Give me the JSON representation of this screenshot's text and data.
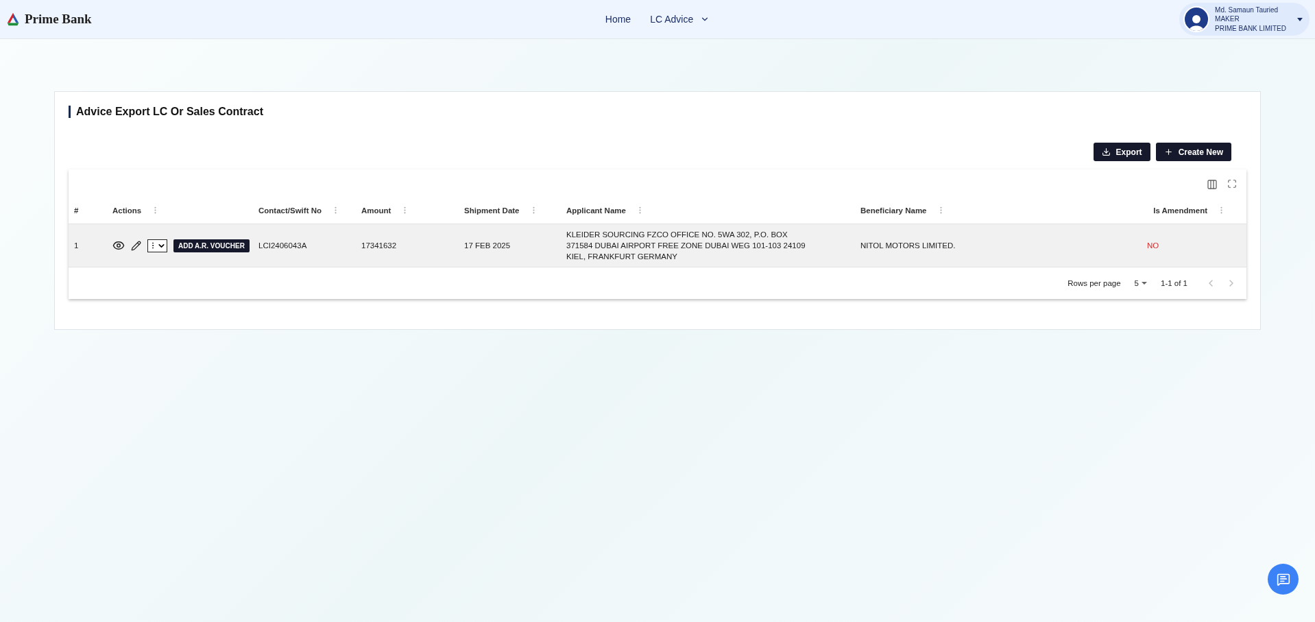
{
  "header": {
    "brand": "Prime Bank",
    "nav": [
      {
        "label": "Home",
        "has_menu": false
      },
      {
        "label": "LC Advice",
        "has_menu": true
      }
    ],
    "user": {
      "name": "Md. Samaun Tauried",
      "role": "MAKER",
      "company": "PRIME BANK LIMITED"
    }
  },
  "page": {
    "title": "Advice Export LC Or Sales Contract",
    "buttons": [
      {
        "kind": "export",
        "label": "Export"
      },
      {
        "kind": "create",
        "label": "Create New"
      }
    ]
  },
  "table": {
    "columns": [
      {
        "label": "#",
        "menu": false
      },
      {
        "label": "Actions",
        "menu": true
      },
      {
        "label": "Contact/Swift No",
        "menu": true
      },
      {
        "label": "Amount",
        "menu": true
      },
      {
        "label": "Shipment Date",
        "menu": true
      },
      {
        "label": "Applicant Name",
        "menu": true
      },
      {
        "label": "Beneficiary Name",
        "menu": true
      },
      {
        "label": "Is Amendment",
        "menu": true
      }
    ],
    "rows": [
      {
        "index": "1",
        "voucher_button": "ADD A.R. VOUCHER",
        "swift_no": "LCI2406043A",
        "amount": "17341632",
        "shipment_date": "17 FEB 2025",
        "applicant": "KLEIDER SOURCING FZCO OFFICE NO. 5WA 302, P.O. BOX 371584 DUBAI AIRPORT FREE ZONE DUBAI WEG 101-103 24109 KIEL, FRANKFURT GERMANY",
        "beneficiary": "NITOL MOTORS LIMITED.",
        "is_amendment": "NO"
      }
    ],
    "pagination": {
      "rows_per_page_label": "Rows per page",
      "rows_per_page": "5",
      "range": "1-1 of 1"
    }
  }
}
